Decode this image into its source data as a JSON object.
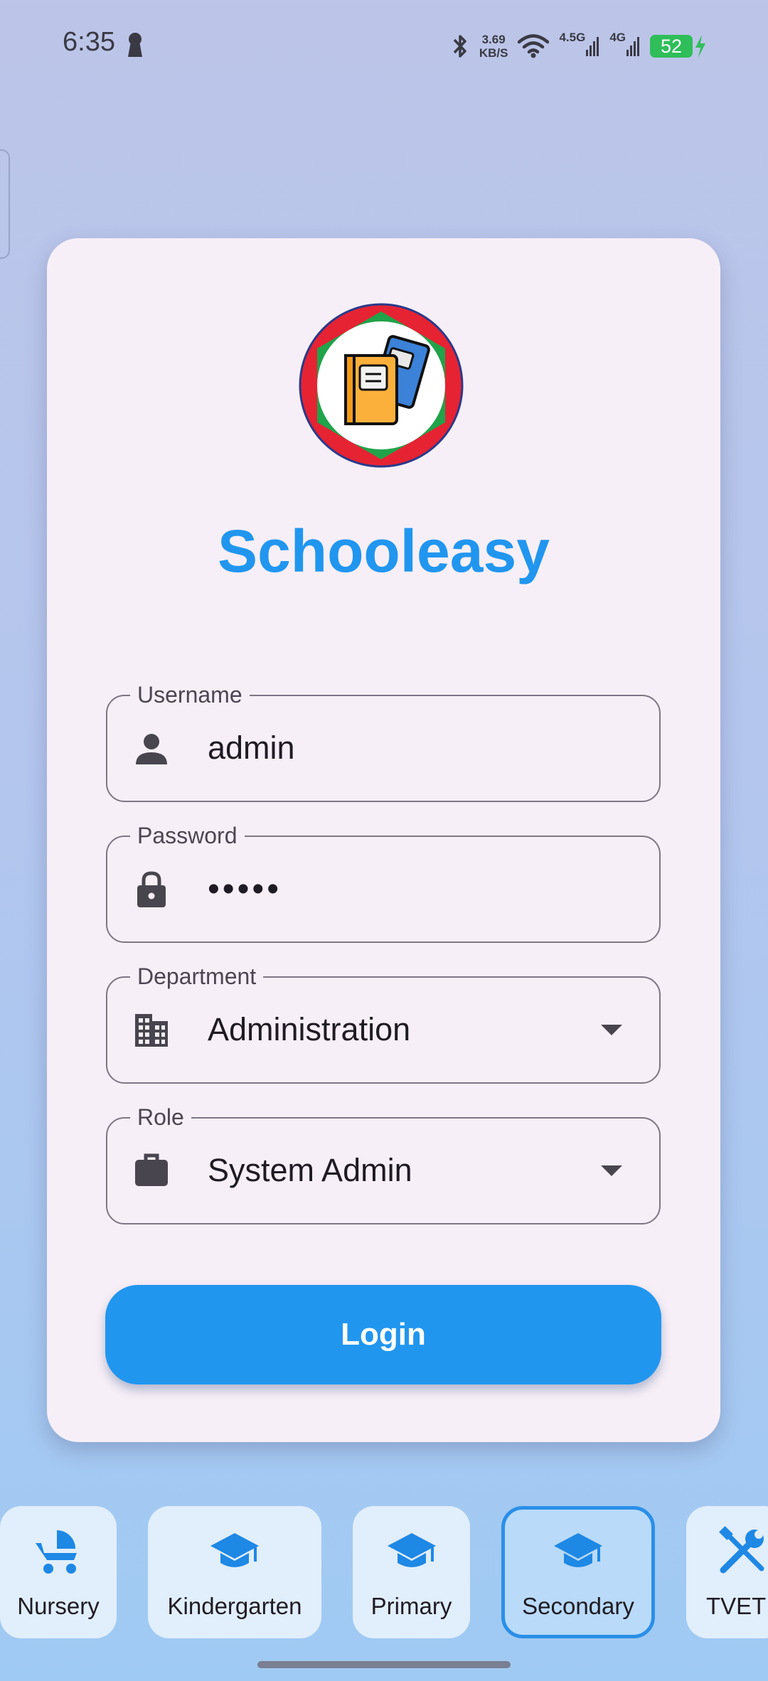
{
  "status_bar": {
    "time": "6:35",
    "speed_value": "3.69",
    "speed_unit": "KB/S",
    "signal_1": "4.5G",
    "signal_2": "4G",
    "battery": "52"
  },
  "app": {
    "title": "Schooleasy",
    "logo_icon": "books-icon",
    "accent_color": "#2196EF"
  },
  "form": {
    "username": {
      "label": "Username",
      "value": "admin",
      "icon": "person-icon"
    },
    "password": {
      "label": "Password",
      "value": "•••••",
      "icon": "lock-icon"
    },
    "department": {
      "label": "Department",
      "value": "Administration",
      "icon": "building-icon"
    },
    "role": {
      "label": "Role",
      "value": "System Admin",
      "icon": "briefcase-icon"
    },
    "login_label": "Login"
  },
  "levels": [
    {
      "label": "Nursery",
      "icon": "stroller-icon",
      "selected": false
    },
    {
      "label": "Kindergarten",
      "icon": "graduation-cap-icon",
      "selected": false
    },
    {
      "label": "Primary",
      "icon": "graduation-cap-icon",
      "selected": false
    },
    {
      "label": "Secondary",
      "icon": "graduation-cap-icon",
      "selected": true
    },
    {
      "label": "TVET",
      "icon": "tools-icon",
      "selected": false
    }
  ]
}
